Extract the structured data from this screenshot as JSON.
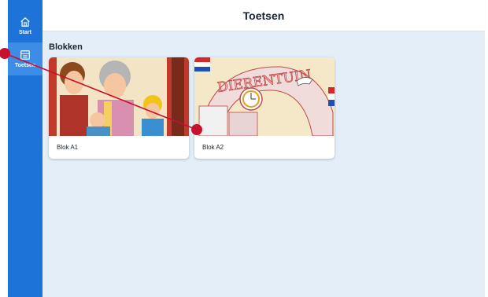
{
  "header": {
    "title": "Toetsen"
  },
  "sidebar": {
    "items": [
      {
        "label": "Start",
        "icon": "home-icon"
      },
      {
        "label": "Toetsen",
        "icon": "grid-list-icon"
      }
    ]
  },
  "section": {
    "title": "Blokken"
  },
  "cards": [
    {
      "label": "Blok A1"
    },
    {
      "label": "Blok A2",
      "image_sign": "DIERENTUIN"
    }
  ],
  "colors": {
    "sidebar": "#1e73d8",
    "background": "#e4eef8",
    "annotation": "#c8102e"
  }
}
